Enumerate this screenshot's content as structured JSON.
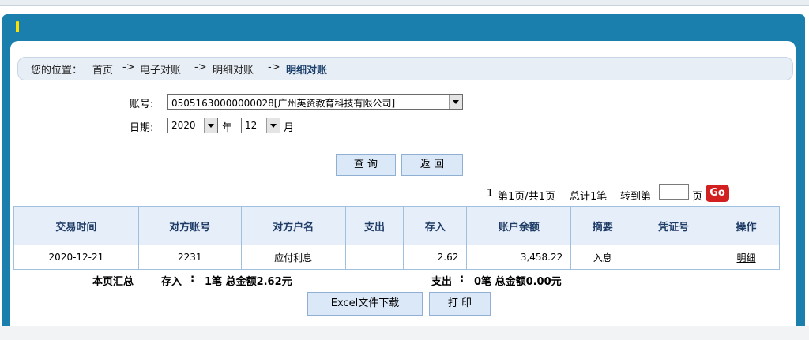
{
  "breadcrumb": {
    "prefix": "您的位置：",
    "items": [
      "首页",
      "电子对账",
      "明细对账"
    ],
    "separator": "->",
    "current": "明细对账"
  },
  "form": {
    "account_label": "账号:",
    "account_value": "05051630000000028[广州英资教育科技有限公司]",
    "date_label": "日期:",
    "year_value": "2020",
    "year_unit": "年",
    "month_value": "12",
    "month_unit": "月"
  },
  "buttons": {
    "query": "查 询",
    "back": "返 回",
    "excel": "Excel文件下载",
    "print": "打 印"
  },
  "pager": {
    "current_page": "1",
    "info": "第1页/共1页",
    "total": "总计1笔",
    "goto_label": "转到第",
    "page_unit": "页",
    "go": "Go"
  },
  "table": {
    "headers": [
      "交易时间",
      "对方账号",
      "对方户名",
      "支出",
      "存入",
      "账户余额",
      "摘要",
      "凭证号",
      "操作"
    ],
    "rows": [
      [
        "2020-12-21",
        "2231",
        "应付利息",
        "",
        "2.62",
        "3,458.22",
        "入息",
        "",
        "明细"
      ]
    ]
  },
  "summary": {
    "label": "本页汇总",
    "deposit_tag": "存入",
    "deposit_text": "1笔  总金额2.62元",
    "withdraw_tag": "支出",
    "withdraw_text": "0笔  总金额0.00元"
  },
  "colors": {
    "frame": "#1a7fad",
    "header_bg": "#e6eff9",
    "accent_red": "#e0201b",
    "pager_orange": "#ff6600"
  }
}
